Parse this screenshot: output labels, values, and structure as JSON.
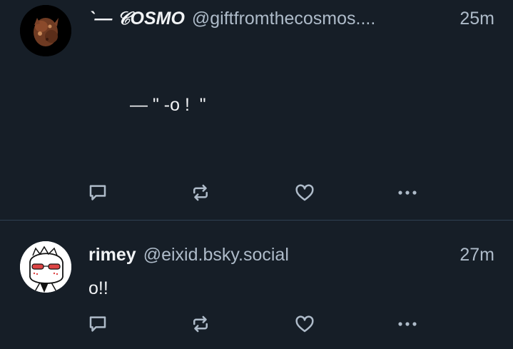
{
  "posts": [
    {
      "display_name": "`— 𝒞OSMO",
      "handle": "@giftfromthecosmos....",
      "time": "25m",
      "text": "— \" -o !  \""
    },
    {
      "display_name": "rimey",
      "handle": "@eixid.bsky.social",
      "time": "27m",
      "text": "o!!"
    }
  ],
  "icons": {
    "reply": "reply-icon",
    "repost": "repost-icon",
    "like": "like-icon",
    "more": "more-icon"
  },
  "colors": {
    "background": "#161e27",
    "divider": "#2e4052",
    "icon": "#aebbc9",
    "text": "#f1f3f5",
    "muted": "#aebbc9"
  }
}
